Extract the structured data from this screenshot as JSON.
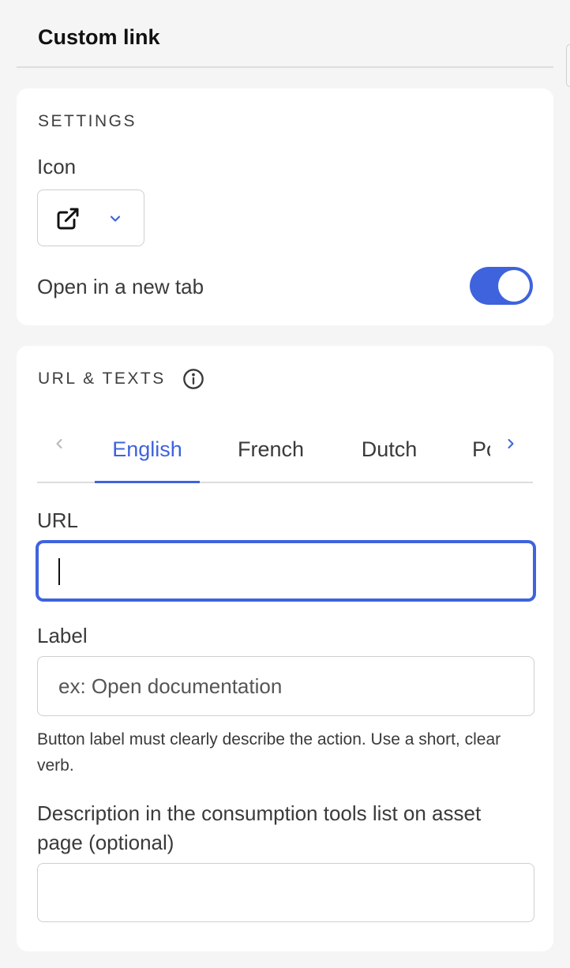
{
  "header": {
    "title": "Custom link"
  },
  "settings": {
    "section_title": "SETTINGS",
    "icon_label": "Icon",
    "selected_icon": "external-link-icon",
    "new_tab_label": "Open in a new tab",
    "new_tab_enabled": true
  },
  "url_texts": {
    "section_title": "URL & TEXTS",
    "tabs": [
      {
        "label": "English",
        "active": true
      },
      {
        "label": "French",
        "active": false
      },
      {
        "label": "Dutch",
        "active": false
      },
      {
        "label": "Portuguese",
        "active": false
      }
    ],
    "url_label": "URL",
    "url_value": "",
    "label_label": "Label",
    "label_placeholder": "ex: Open documentation",
    "label_help": "Button label must clearly describe the action. Use a short, clear verb.",
    "description_label": "Description in the consumption tools list on asset page (optional)",
    "description_value": ""
  },
  "colors": {
    "accent": "#3e63dd",
    "background": "#f5f5f5",
    "card": "#ffffff",
    "border": "#cfcfcf"
  }
}
